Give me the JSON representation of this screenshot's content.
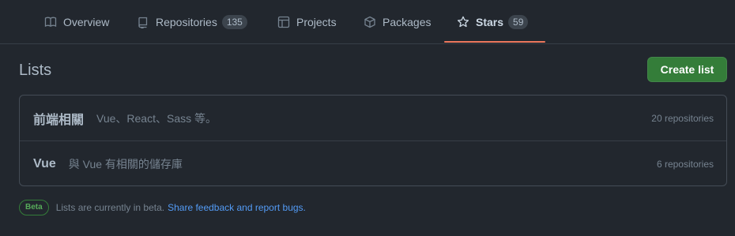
{
  "tabs": [
    {
      "label": "Overview",
      "icon": "book-icon",
      "count": null,
      "selected": false
    },
    {
      "label": "Repositories",
      "icon": "repo-icon",
      "count": "135",
      "selected": false
    },
    {
      "label": "Projects",
      "icon": "table-icon",
      "count": null,
      "selected": false
    },
    {
      "label": "Packages",
      "icon": "package-icon",
      "count": null,
      "selected": false
    },
    {
      "label": "Stars",
      "icon": "star-icon",
      "count": "59",
      "selected": true
    }
  ],
  "lists": {
    "title": "Lists",
    "create_label": "Create list",
    "items": [
      {
        "name": "前端相關",
        "description": "Vue、React、Sass 等。",
        "count": "20 repositories"
      },
      {
        "name": "Vue",
        "description": "與 Vue 有相關的儲存庫",
        "count": "6 repositories"
      }
    ]
  },
  "footer": {
    "badge": "Beta",
    "text": "Lists are currently in beta.",
    "link": "Share feedback and report bugs."
  },
  "colors": {
    "background": "#22272e",
    "accent_underline": "#ec775c",
    "primary_button": "#347d39",
    "link": "#539bf5"
  }
}
